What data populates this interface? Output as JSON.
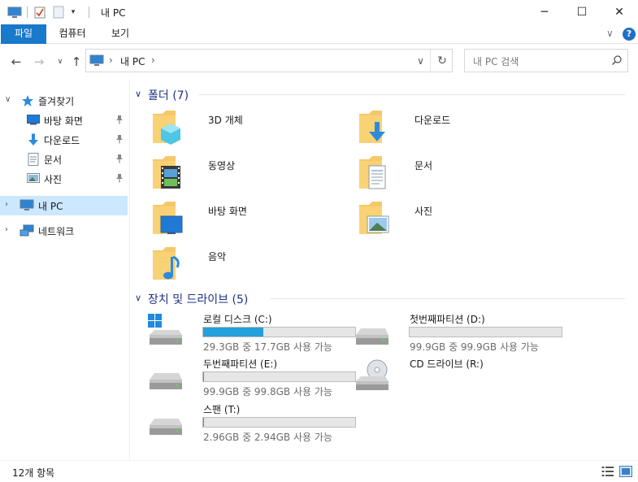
{
  "window": {
    "title": "내 PC",
    "controls": {
      "minimize": "─",
      "maximize": "☐",
      "close": "✕"
    }
  },
  "ribbon": {
    "tabs": [
      "파일",
      "컴퓨터",
      "보기"
    ],
    "help": "?"
  },
  "nav": {
    "address_location": "내 PC",
    "search_placeholder": "내 PC 검색"
  },
  "sidebar": {
    "items": [
      {
        "label": "즐겨찾기",
        "icon": "star-icon"
      },
      {
        "label": "바탕 화면",
        "icon": "desktop-icon",
        "pinned": true
      },
      {
        "label": "다운로드",
        "icon": "download-icon",
        "pinned": true
      },
      {
        "label": "문서",
        "icon": "document-icon",
        "pinned": true
      },
      {
        "label": "사진",
        "icon": "pictures-icon",
        "pinned": true
      },
      {
        "label": "내 PC",
        "icon": "computer-icon",
        "selected": true
      },
      {
        "label": "네트워크",
        "icon": "network-icon"
      }
    ]
  },
  "folders_group": {
    "title": "폴더 (7)",
    "items": [
      {
        "label": "3D 개체",
        "icon": "3d-objects-folder-icon"
      },
      {
        "label": "다운로드",
        "icon": "downloads-folder-icon"
      },
      {
        "label": "동영상",
        "icon": "videos-folder-icon"
      },
      {
        "label": "문서",
        "icon": "documents-folder-icon"
      },
      {
        "label": "바탕 화면",
        "icon": "desktop-folder-icon"
      },
      {
        "label": "사진",
        "icon": "pictures-folder-icon"
      },
      {
        "label": "음악",
        "icon": "music-folder-icon"
      }
    ]
  },
  "drives_group": {
    "title": "장치 및 드라이브 (5)",
    "items": [
      {
        "name": "로컬 디스크 (C:)",
        "free": "29.3GB 중 17.7GB 사용 가능",
        "used_fraction": 0.396,
        "icon": "windows-drive-icon"
      },
      {
        "name": "첫번째파티션 (D:)",
        "free": "99.9GB 중 99.9GB 사용 가능",
        "used_fraction": 0.0,
        "icon": "hard-drive-icon"
      },
      {
        "name": "두번째파티션 (E:)",
        "free": "99.9GB 중 99.8GB 사용 가능",
        "used_fraction": 0.001,
        "icon": "hard-drive-icon"
      },
      {
        "name": "CD 드라이브 (R:)",
        "icon": "cd-drive-icon"
      },
      {
        "name": "스팬 (T:)",
        "free": "2.96GB 중 2.94GB 사용 가능",
        "used_fraction": 0.007,
        "icon": "hard-drive-icon"
      }
    ]
  },
  "status": {
    "item_count": "12개 항목"
  },
  "colors": {
    "accent": "#1979ca",
    "group_header": "#1e3287",
    "progress": "#26a0da",
    "selection": "#cce8ff"
  }
}
